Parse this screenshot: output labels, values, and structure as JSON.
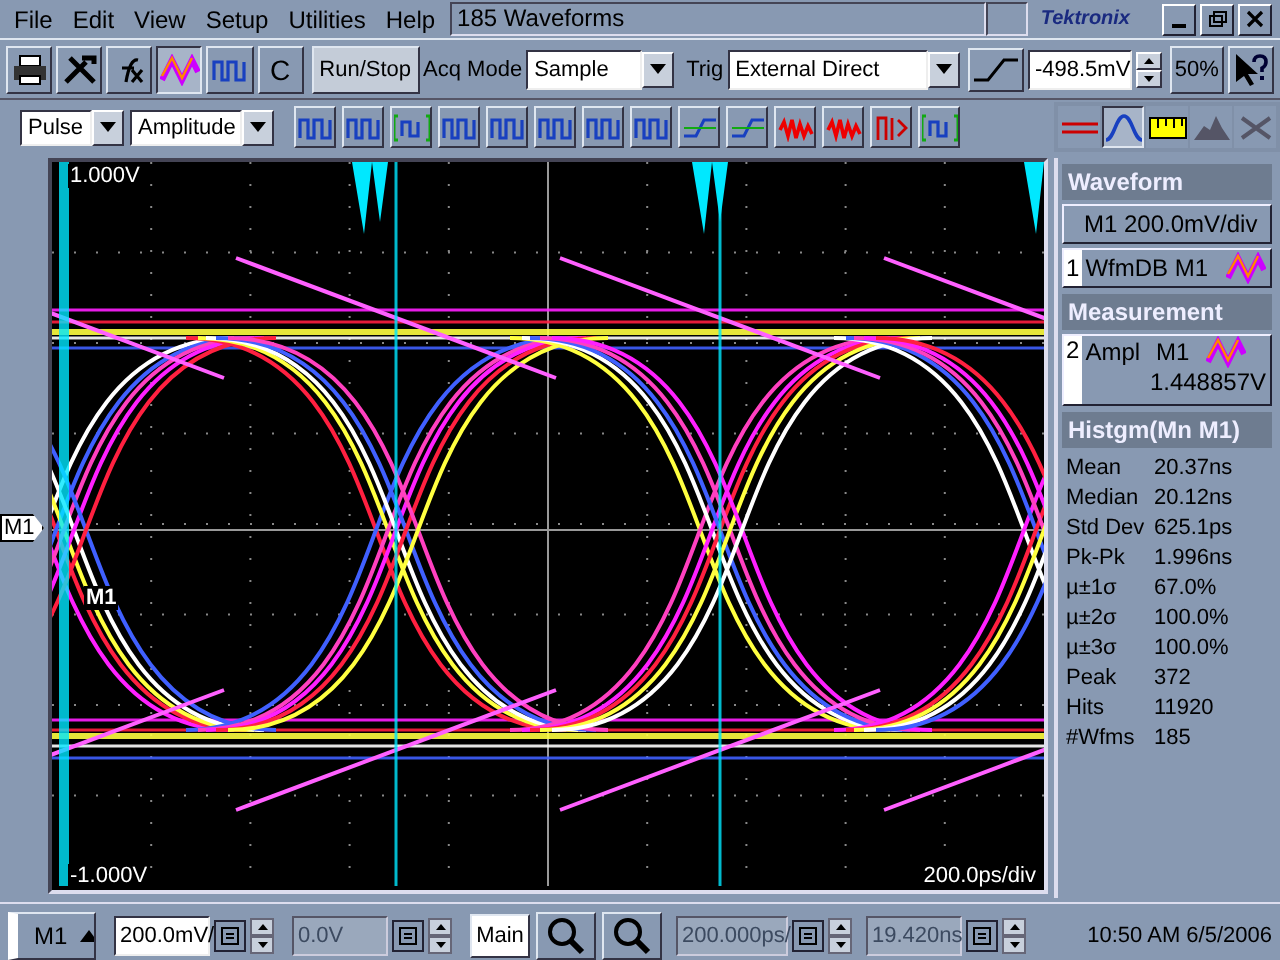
{
  "menu": [
    "File",
    "Edit",
    "View",
    "Setup",
    "Utilities",
    "Help"
  ],
  "title": "185 Waveforms",
  "logo": "Tektronix",
  "tools": [
    {
      "kind": "printer",
      "selected": false
    },
    {
      "kind": "tools",
      "selected": false
    },
    {
      "kind": "fx",
      "selected": false
    },
    {
      "kind": "waveform",
      "selected": true
    },
    {
      "kind": "pulse",
      "selected": false
    },
    {
      "kind": "text",
      "label": "C",
      "selected": false
    }
  ],
  "run_stop": "Run/Stop",
  "acq_mode_label": "Acq Mode",
  "acq_mode": "Sample",
  "trig_label": "Trig",
  "trig_source": "External Direct",
  "trig_level": "-498.5mV",
  "zoom_percent": "50%",
  "measure_group": "Pulse",
  "measure_type": "Amplitude",
  "measure_tools": [
    {
      "kind": "pulse"
    },
    {
      "kind": "pulse"
    },
    {
      "kind": "bracket"
    },
    {
      "kind": "pulse"
    },
    {
      "kind": "pulse"
    },
    {
      "kind": "pulse"
    },
    {
      "kind": "pulse"
    },
    {
      "kind": "pulse"
    },
    {
      "kind": "edge"
    },
    {
      "kind": "edge"
    },
    {
      "kind": "noise"
    },
    {
      "kind": "noise"
    },
    {
      "kind": "bars"
    },
    {
      "kind": "bracket"
    }
  ],
  "view_tools": [
    {
      "kind": "lines",
      "selected": false
    },
    {
      "kind": "waveform",
      "selected": true
    },
    {
      "kind": "ruler",
      "selected": false
    },
    {
      "kind": "histogram",
      "selected": false
    },
    {
      "kind": "cross",
      "selected": false
    }
  ],
  "display": {
    "top_label": "1.000V",
    "bottom_label": "-1.000V",
    "timebase": "200.0ps/div",
    "trace_label": "M1",
    "marker": "M1"
  },
  "waveform_title": "Waveform",
  "waveform_scale": "M1 200.0mV/div",
  "waveform_db": {
    "index": "1",
    "text": "WfmDB M1"
  },
  "measurement_title": "Measurement",
  "measurement": {
    "index": "2",
    "name": "Ampl",
    "source": "M1",
    "value": "1.448857V"
  },
  "histogram_title": "Histgm(Mn M1)",
  "stats": [
    {
      "label": "Mean",
      "value": "20.37ns"
    },
    {
      "label": "Median",
      "value": "20.12ns"
    },
    {
      "label": "Std Dev",
      "value": "625.1ps"
    },
    {
      "label": "Pk-Pk",
      "value": "1.996ns"
    },
    {
      "label": "µ±1σ",
      "value": "67.0%"
    },
    {
      "label": "µ±2σ",
      "value": "100.0%"
    },
    {
      "label": "µ±3σ",
      "value": "100.0%"
    },
    {
      "label": "Peak",
      "value": "372"
    },
    {
      "label": "Hits",
      "value": "11920"
    },
    {
      "label": "#Wfms",
      "value": "185"
    }
  ],
  "bottom": {
    "channel": "M1",
    "fields": [
      {
        "value": "200.0mV/",
        "disabled": false
      },
      {
        "value": "0.0V",
        "disabled": true
      }
    ],
    "main": "Main",
    "hfields": [
      {
        "value": "200.000ps/",
        "disabled": true
      },
      {
        "value": "19.420ns",
        "disabled": true
      }
    ],
    "datetime": "10:50 AM 6/5/2006"
  }
}
